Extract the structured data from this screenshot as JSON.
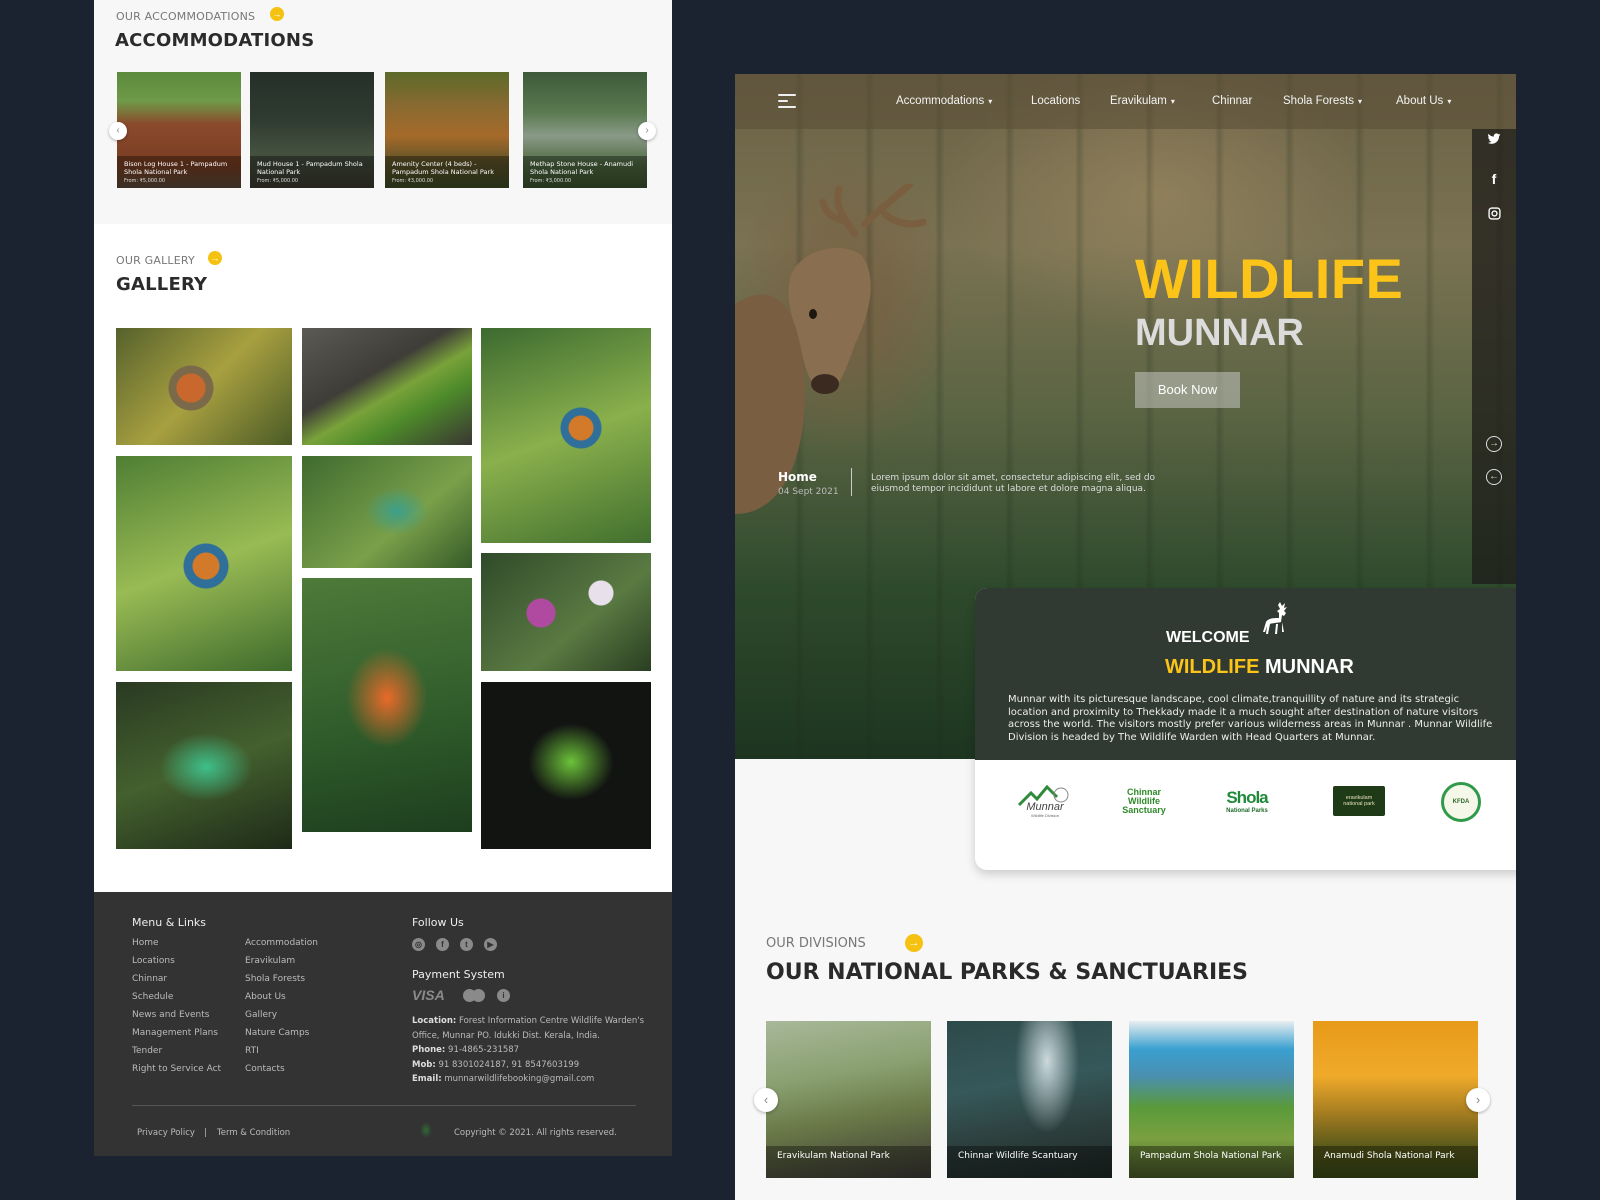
{
  "left": {
    "accommodations": {
      "eyebrow": "OUR ACCOMMODATIONS",
      "title": "ACCOMMODATIONS",
      "arrow_icon": "arrow-right-icon",
      "cards": [
        {
          "name": "Bison Log House 1 - Pampadum Shola National Park",
          "price": "From: ₹5,000.00"
        },
        {
          "name": "Mud House 1 - Pampadum Shola National Park",
          "price": "From: ₹5,000.00"
        },
        {
          "name": "Amenity Center (4 beds) - Pampadum Shola National Park",
          "price": "From: ₹3,000.00"
        },
        {
          "name": "Methap Stone House - Anamudi Shola National Park",
          "price": "From: ₹3,000.00"
        }
      ],
      "prev_icon": "‹",
      "next_icon": "›"
    },
    "gallery": {
      "eyebrow": "OUR GALLERY",
      "title": "GALLERY",
      "items": [
        "robin",
        "chameleon",
        "kingfisher",
        "kingfisher-2",
        "chameleon-2",
        "orchid-flowers",
        "lily",
        "green-python",
        "green-python-2"
      ]
    },
    "footer": {
      "menu_title": "Menu & Links",
      "links_col1": [
        "Home",
        "Locations",
        "Chinnar",
        "Schedule",
        "News and Events",
        "Management Plans",
        "Tender",
        "Right to Service Act"
      ],
      "links_col2": [
        "Accommodation",
        "Eravikulam",
        "Shola Forests",
        "About Us",
        "Gallery",
        "Nature Camps",
        "RTI",
        "Contacts"
      ],
      "follow_title": "Follow Us",
      "social_icons": [
        "instagram-icon",
        "facebook-icon",
        "twitter-icon",
        "youtube-icon"
      ],
      "payment_title": "Payment System",
      "payment_visa": "VISA",
      "payment_icons": [
        "visa-icon",
        "mastercard-icon",
        "sbi-icon"
      ],
      "location_label": "Location:",
      "location_value": "Forest Information Centre Wildlife Warden's Office, Munnar PO. Idukki Dist. Kerala, India.",
      "phone_label": "Phone:",
      "phone_value": "91-4865-231587",
      "mob_label": "Mob:",
      "mob_value": "91 8301024187, 91 8547603199",
      "email_label": "Email:",
      "email_value": "munnarwildlifebooking@gmail.com",
      "privacy": "Privacy Policy",
      "separator": "|",
      "terms": "Term & Condition",
      "copyright": "Copyright © 2021. All rights reserved."
    }
  },
  "right": {
    "nav": {
      "items": [
        {
          "label": "Accommodations",
          "dropdown": true
        },
        {
          "label": "Locations",
          "dropdown": false
        },
        {
          "label": "Eravikulam",
          "dropdown": true
        },
        {
          "label": "Chinnar",
          "dropdown": false
        },
        {
          "label": "Shola Forests",
          "dropdown": true
        },
        {
          "label": "About Us",
          "dropdown": true
        }
      ],
      "chevron": "⌄"
    },
    "hero": {
      "title_1": "WILDLIFE",
      "title_2": "MUNNAR",
      "book_button": "Book Now",
      "breadcrumb_home": "Home",
      "breadcrumb_date": "04 Sept 2021",
      "breadcrumb_text": "Lorem ipsum dolor sit amet, consectetur adipiscing elit, sed do eiusmod tempor incididunt ut labore et dolore magna aliqua.",
      "social": [
        "twitter-icon",
        "facebook-icon",
        "instagram-icon"
      ],
      "next_arrow": "→",
      "prev_arrow": "←"
    },
    "welcome": {
      "line_1": "WELCOME",
      "line_2_highlight": "WILDLIFE",
      "line_2_rest": "MUNNAR",
      "body": "Munnar with its picturesque landscape, cool climate,tranquillity of nature and its strategic location and proximity to Thekkady made it a much sought after destination of nature visitors across the world. The visitors mostly prefer various wilderness areas in Munnar . Munnar Wildlife Division is headed by The Wildlife Warden with Head Quarters at Munnar.",
      "logos": [
        {
          "name": "munnar-wildlife-division-logo",
          "text": "Munnar",
          "sub": "Wildlife Division"
        },
        {
          "name": "chinnar-wildlife-sanctuary-logo",
          "text": "Chinnar Wildlife Sanctuary",
          "sub": ""
        },
        {
          "name": "shola-national-parks-logo",
          "text": "Shola",
          "sub": "National Parks"
        },
        {
          "name": "eravikulam-national-park-logo",
          "text": "eravikulam national park",
          "sub": ""
        },
        {
          "name": "kfdc-emblem-logo",
          "text": "KFDA",
          "sub": ""
        }
      ]
    },
    "divisions": {
      "eyebrow": "OUR DIVISIONS",
      "title": "OUR NATIONAL PARKS & SANCTUARIES",
      "cards": [
        {
          "label": "Eravikulam National Park"
        },
        {
          "label": "Chinnar Wildlife Scantuary"
        },
        {
          "label": "Pampadum Shola National Park"
        },
        {
          "label": "Anamudi Shola National Park"
        }
      ],
      "prev_icon": "‹",
      "next_icon": "›"
    },
    "colors": {
      "accent_yellow": "#fcc419",
      "footer_bg": "#333333",
      "page_bg": "#1b2230"
    }
  }
}
